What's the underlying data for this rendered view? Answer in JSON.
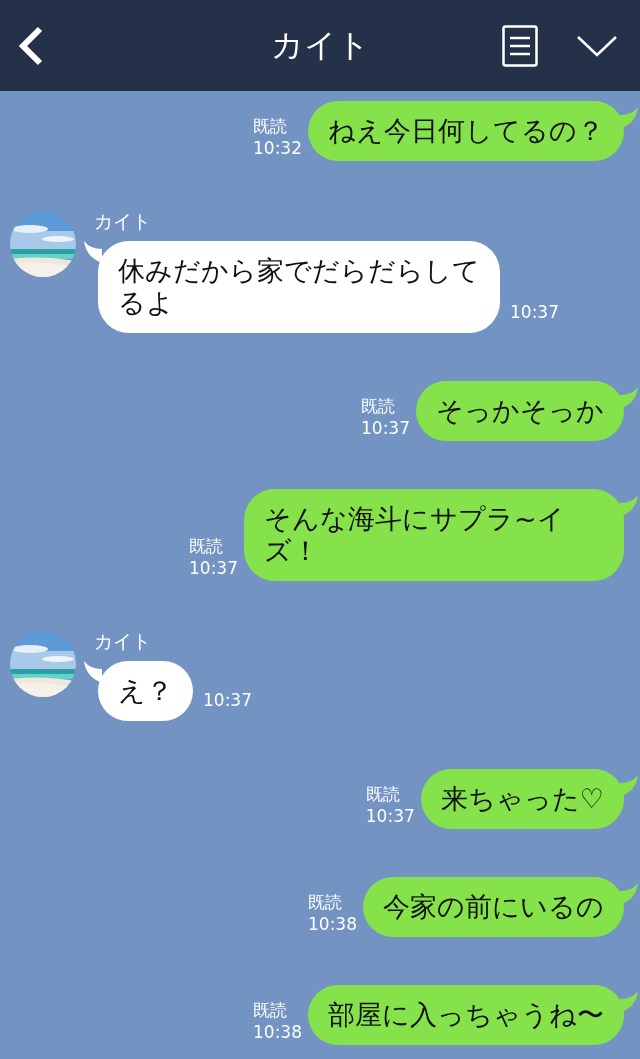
{
  "header": {
    "title": "カイト"
  },
  "messages": [
    {
      "kind": "sent",
      "text": "ねえ今日何してるの？",
      "read": "既読",
      "time": "10:32"
    },
    {
      "kind": "received",
      "sender": "カイト",
      "text": "休みだから家でだらだらしてるよ",
      "time": "10:37"
    },
    {
      "kind": "sent",
      "text": "そっかそっか",
      "read": "既読",
      "time": "10:37"
    },
    {
      "kind": "sent",
      "text": "そんな海斗にサプラ~イズ！",
      "read": "既読",
      "time": "10:37"
    },
    {
      "kind": "received",
      "sender": "カイト",
      "text": "え？",
      "time": "10:37"
    },
    {
      "kind": "sent",
      "text": "来ちゃった♡",
      "read": "既読",
      "time": "10:37"
    },
    {
      "kind": "sent",
      "text": "今家の前にいるの",
      "read": "既読",
      "time": "10:38"
    },
    {
      "kind": "sent",
      "text": "部屋に入っちゃうね〜",
      "read": "既読",
      "time": "10:38"
    }
  ]
}
